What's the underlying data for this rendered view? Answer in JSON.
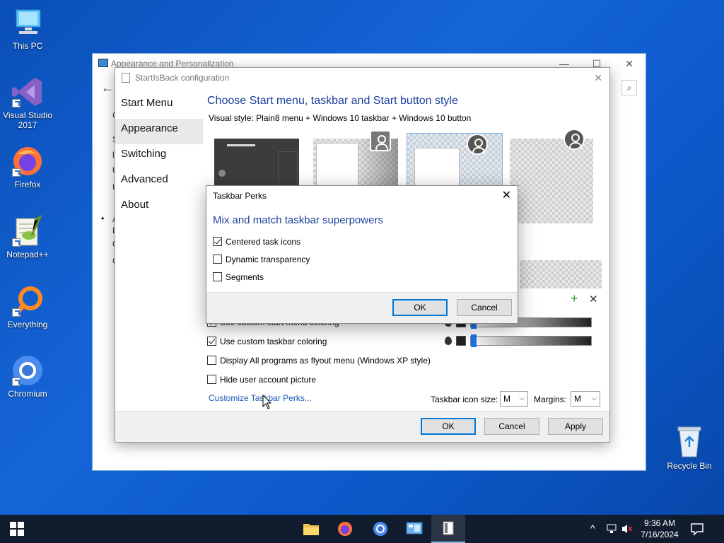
{
  "desktop": {
    "icons": [
      {
        "label": "This PC",
        "icon": "this-pc-icon"
      },
      {
        "label": "Visual Studio 2017",
        "icon": "visual-studio-icon"
      },
      {
        "label": "Firefox",
        "icon": "firefox-icon"
      },
      {
        "label": "Notepad++",
        "icon": "notepadpp-icon"
      },
      {
        "label": "Everything",
        "icon": "everything-icon"
      },
      {
        "label": "Chromium",
        "icon": "chromium-icon"
      }
    ],
    "recycle_bin": "Recycle Bin"
  },
  "back_window": {
    "title": "Appearance and Personalization",
    "controls": {
      "minimize": "—",
      "maximize": "☐",
      "close": "✕"
    },
    "back_arrow": "←",
    "search_icon": "⌕",
    "bullet": "•",
    "fragments": [
      "C",
      "S",
      "l",
      "U",
      "U",
      "A",
      "L",
      "C",
      "C"
    ]
  },
  "config": {
    "title": "StartIsBack configuration",
    "close": "✕",
    "sidebar": [
      "Start Menu",
      "Appearance",
      "Switching",
      "Advanced",
      "About"
    ],
    "active_sidebar_index": 1,
    "heading": "Choose Start menu, taskbar and Start button style",
    "visual_style": "Visual style:  Plain8 menu + Windows 10 taskbar + Windows 10 button",
    "options": [
      {
        "label": "Use custom start menu coloring",
        "checked": true
      },
      {
        "label": "Use custom taskbar coloring",
        "checked": true
      },
      {
        "label": "Display All programs as flyout menu (Windows XP style)",
        "checked": false
      },
      {
        "label": "Hide user account picture",
        "checked": false
      }
    ],
    "plus": "+",
    "remove": "✕",
    "link": "Customize Taskbar Perks...",
    "icon_size_label": "Taskbar icon size:",
    "icon_size_value": "M",
    "margins_label": "Margins:",
    "margins_value": "M",
    "chevron": "⌵",
    "buttons": {
      "ok": "OK",
      "cancel": "Cancel",
      "apply": "Apply"
    }
  },
  "dialog": {
    "title": "Taskbar Perks",
    "close": "✕",
    "heading": "Mix and match taskbar superpowers",
    "options": [
      {
        "label": "Centered task icons",
        "checked": true
      },
      {
        "label": "Dynamic transparency",
        "checked": false
      },
      {
        "label": "Segments",
        "checked": false
      }
    ],
    "buttons": {
      "ok": "OK",
      "cancel": "Cancel"
    }
  },
  "taskbar": {
    "time": "9:36 AM",
    "date": "7/16/2024",
    "tray_chevron": "^",
    "colors": {
      "background": "#111c2e",
      "accent": "#0078d7"
    }
  }
}
